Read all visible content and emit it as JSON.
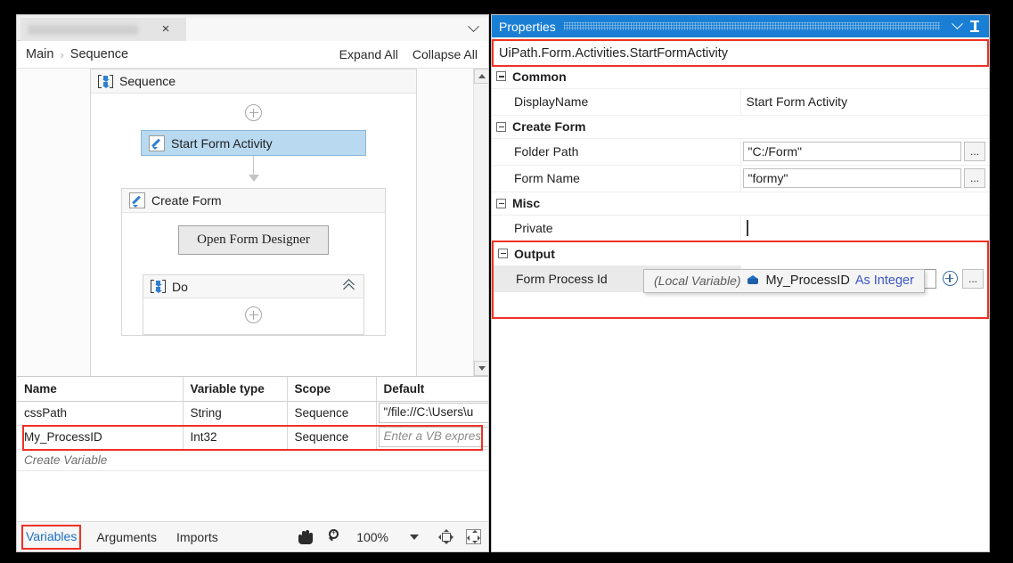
{
  "designer": {
    "tab": {
      "label_redacted": true,
      "close_label": "×"
    },
    "breadcrumb": {
      "root": "Main",
      "separator": "›",
      "current": "Sequence"
    },
    "actions": {
      "expand_all": "Expand All",
      "collapse_all": "Collapse All"
    },
    "canvas": {
      "sequence": {
        "title": "Sequence",
        "icon": "sequence-icon"
      },
      "start_activity": {
        "title": "Start Form Activity",
        "icon": "pencil-icon",
        "selected": true
      },
      "create_form": {
        "title": "Create Form",
        "icon": "pencil-icon"
      },
      "open_designer_button": "Open Form Designer",
      "do_block": {
        "title": "Do",
        "icon": "sequence-icon",
        "collapse_icon": "double-chevron-up-icon"
      }
    }
  },
  "variables_panel": {
    "columns": [
      "Name",
      "Variable type",
      "Scope",
      "Default"
    ],
    "rows": [
      {
        "name": "cssPath",
        "type": "String",
        "scope": "Sequence",
        "default": "\"/file://C:\\Users\\u",
        "default_is_placeholder": false,
        "highlighted": false
      },
      {
        "name": "My_ProcessID",
        "type": "Int32",
        "scope": "Sequence",
        "default": "Enter a VB expres",
        "default_is_placeholder": true,
        "highlighted": true
      }
    ],
    "create_variable": "Create Variable"
  },
  "bottom_toolbar": {
    "tabs": [
      {
        "label": "Variables",
        "active": true,
        "highlighted": true
      },
      {
        "label": "Arguments",
        "active": false,
        "highlighted": false
      },
      {
        "label": "Imports",
        "active": false,
        "highlighted": false
      }
    ],
    "pan_icon": "hand-icon",
    "zoom_icon": "magnifier-icon",
    "zoom_level": "100%",
    "zoom_caret": "caret-down-icon",
    "fit_to_screen_icon": "fit-to-screen-icon",
    "overview_icon": "overview-icon"
  },
  "properties": {
    "panel_title": "Properties",
    "collapse_icon": "chevron-down-icon",
    "pin_icon": "pin-icon",
    "activity_type": "UiPath.Form.Activities.StartFormActivity",
    "activity_type_highlighted": true,
    "sections": [
      {
        "name": "Common",
        "expanded": true,
        "rows": [
          {
            "label": "DisplayName",
            "value": "Start Form Activity",
            "kind": "text"
          }
        ]
      },
      {
        "name": "Create Form",
        "expanded": true,
        "rows": [
          {
            "label": "Folder Path",
            "value": "\"C:/Form\"",
            "kind": "input",
            "browse": "..."
          },
          {
            "label": "Form Name",
            "value": "\"formy\"",
            "kind": "input",
            "browse": "..."
          }
        ]
      },
      {
        "name": "Misc",
        "expanded": true,
        "rows": [
          {
            "label": "Private",
            "value": "",
            "kind": "checkbox",
            "checked": false
          }
        ]
      },
      {
        "name": "Output",
        "expanded": true,
        "highlighted": true,
        "rows": [
          {
            "label": "Form Process Id",
            "value": "My_ProcessID",
            "kind": "input-with-add",
            "focused": true,
            "add_icon": "plus-circle-icon",
            "browse": "..."
          }
        ]
      }
    ],
    "intellisense": {
      "visible": true,
      "kind_label": "(Local Variable)",
      "glyph": "variable-cube-icon",
      "name": "My_ProcessID",
      "type_text": "As Integer"
    }
  },
  "colors": {
    "titlebar_blue": "#1a7fd4",
    "highlight_red": "#ee3124",
    "selection_blue": "#b8d9f0",
    "link_blue": "#1f6fc4",
    "type_purple": "#3a55c8",
    "background_black": "#000000"
  }
}
